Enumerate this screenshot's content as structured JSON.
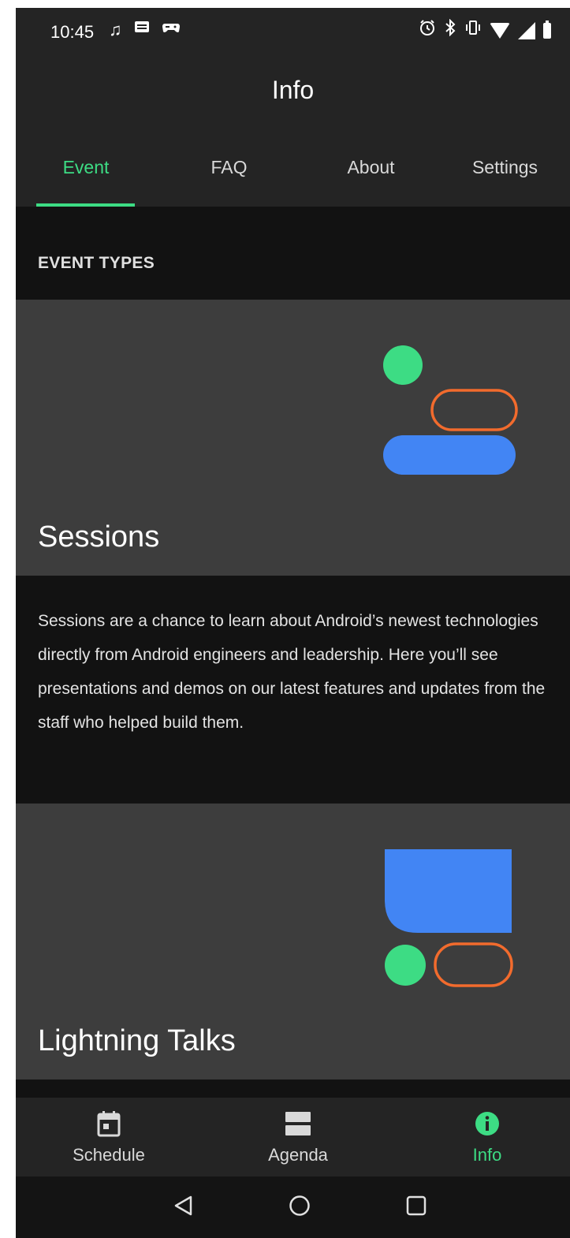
{
  "status_bar": {
    "time": "10:45",
    "left_icons": [
      "music-note-icon",
      "message-icon",
      "game-controller-icon"
    ],
    "right_icons": [
      "alarm-icon",
      "bluetooth-icon",
      "vibrate-icon",
      "wifi-icon",
      "signal-icon",
      "battery-icon"
    ]
  },
  "app_bar": {
    "title": "Info"
  },
  "tabs": [
    {
      "label": "Event",
      "active": true
    },
    {
      "label": "FAQ",
      "active": false
    },
    {
      "label": "About",
      "active": false
    },
    {
      "label": "Settings",
      "active": false
    }
  ],
  "content": {
    "section_header": "EVENT TYPES",
    "cards": [
      {
        "title": "Sessions",
        "description": "Sessions are a chance to learn about Android’s newest technologies directly from Android engineers and leadership. Here you’ll see presentations and demos on our latest features and updates from the staff who helped build them."
      },
      {
        "title": "Lightning Talks",
        "description": ""
      }
    ]
  },
  "bottom_nav": {
    "items": [
      {
        "label": "Schedule",
        "icon": "calendar-icon",
        "active": false
      },
      {
        "label": "Agenda",
        "icon": "agenda-icon",
        "active": false
      },
      {
        "label": "Info",
        "icon": "info-icon",
        "active": true
      }
    ]
  },
  "system_nav": {
    "buttons": [
      "back-icon",
      "home-icon",
      "recents-icon"
    ]
  },
  "colors": {
    "accent_green": "#3ddc84",
    "blue": "#4285f4",
    "orange": "#f26b2d",
    "surface": "#242424",
    "card": "#3d3d3d",
    "background": "#121212"
  }
}
